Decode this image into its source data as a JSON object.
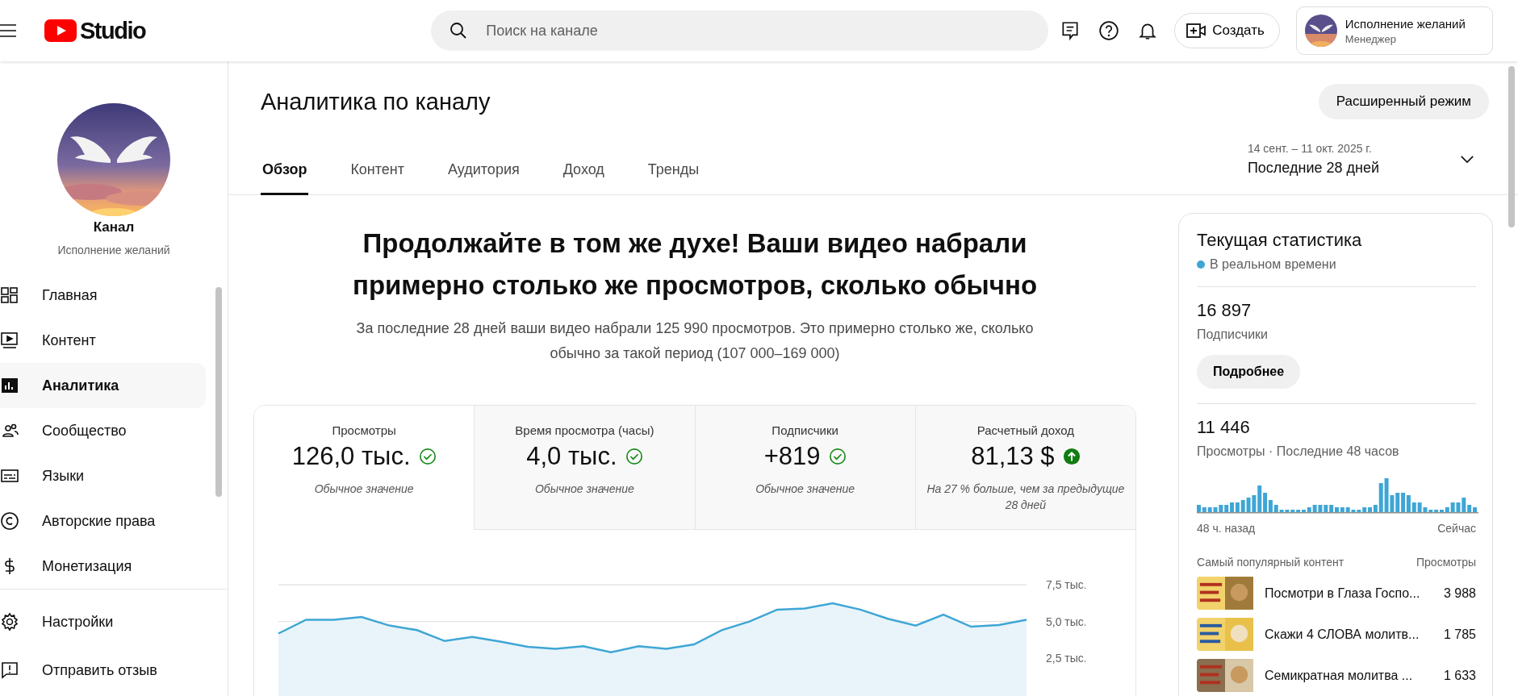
{
  "header": {
    "logo_text": "Studio",
    "search": {
      "placeholder": "Поиск на канале"
    },
    "create_button": "Создать",
    "account": {
      "name": "Исполнение желаний",
      "role": "Менеджер"
    }
  },
  "sidebar": {
    "channel_label": "Канал",
    "channel_name": "Исполнение желаний",
    "items": [
      {
        "label": "Главная",
        "selected": false
      },
      {
        "label": "Контент",
        "selected": false
      },
      {
        "label": "Аналитика",
        "selected": true
      },
      {
        "label": "Сообщество",
        "selected": false
      },
      {
        "label": "Языки",
        "selected": false
      },
      {
        "label": "Авторские права",
        "selected": false
      },
      {
        "label": "Монетизация",
        "selected": false
      }
    ],
    "bottom_items": [
      {
        "label": "Настройки"
      },
      {
        "label": "Отправить отзыв"
      }
    ]
  },
  "page": {
    "title": "Аналитика по каналу",
    "advanced_button": "Расширенный режим",
    "tabs": [
      {
        "label": "Обзор",
        "selected": true
      },
      {
        "label": "Контент",
        "selected": false
      },
      {
        "label": "Аудитория",
        "selected": false
      },
      {
        "label": "Доход",
        "selected": false
      },
      {
        "label": "Тренды",
        "selected": false
      }
    ],
    "date_range": {
      "dates": "14 сент. – 11 окт. 2025 г.",
      "label": "Последние 28 дней"
    }
  },
  "summary": {
    "headline": "Продолжайте в том же духе! Ваши видео набрали\nпримерно столько же просмотров, сколько обычно",
    "text": "За последние 28 дней ваши видео набрали 125 990 просмотров. Это примерно столько же, сколько\nобычно за такой период (107 000–169 000)"
  },
  "metrics": [
    {
      "label": "Просмотры",
      "value": "126,0 тыс.",
      "kind": "normal",
      "note": "Обычное значение",
      "selected": true
    },
    {
      "label": "Время просмотра (часы)",
      "value": "4,0 тыс.",
      "kind": "normal",
      "note": "Обычное значение",
      "selected": false
    },
    {
      "label": "Подписчики",
      "value": "+819",
      "kind": "normal",
      "note": "Обычное значение",
      "selected": false
    },
    {
      "label": "Расчетный доход",
      "value": "81,13 $",
      "kind": "up",
      "note": "На 27 % больше, чем за предыдущие 28 дней",
      "selected": false
    }
  ],
  "chart_data": {
    "type": "area",
    "ylim": [
      0,
      7.5
    ],
    "yticks": [
      {
        "value": 2.5,
        "label": "2,5 тыс."
      },
      {
        "value": 5,
        "label": "5,0 тыс."
      },
      {
        "value": 7.5,
        "label": "7,5 тыс."
      }
    ],
    "values": [
      4.19,
      5.12,
      5.12,
      5.31,
      4.73,
      4.42,
      3.68,
      3.95,
      3.64,
      3.29,
      3.14,
      3.33,
      2.91,
      3.33,
      3.14,
      3.45,
      4.42,
      5.0,
      5.81,
      5.89,
      6.24,
      5.81,
      5.19,
      4.73,
      5.47,
      4.65,
      4.77,
      5.12
    ]
  },
  "realtime": {
    "title": "Текущая статистика",
    "live_label": "В реальном времени",
    "subscribers": {
      "value": "16 897",
      "label": "Подписчики"
    },
    "more_button": "Подробнее",
    "views": {
      "value": "11 446",
      "label": "Просмотры · Последние 48 часов"
    },
    "axis_start": "48 ч. назад",
    "axis_end": "Сейчас",
    "top_header": {
      "title": "Самый популярный контент",
      "views": "Просмотры"
    },
    "top": [
      {
        "title": "Посмотри в Глаза Госпо...",
        "views": "3 988"
      },
      {
        "title": "Скажи 4 СЛОВА молитв...",
        "views": "1 785"
      },
      {
        "title": "Семикратная молитва ...",
        "views": "1 633"
      }
    ]
  }
}
